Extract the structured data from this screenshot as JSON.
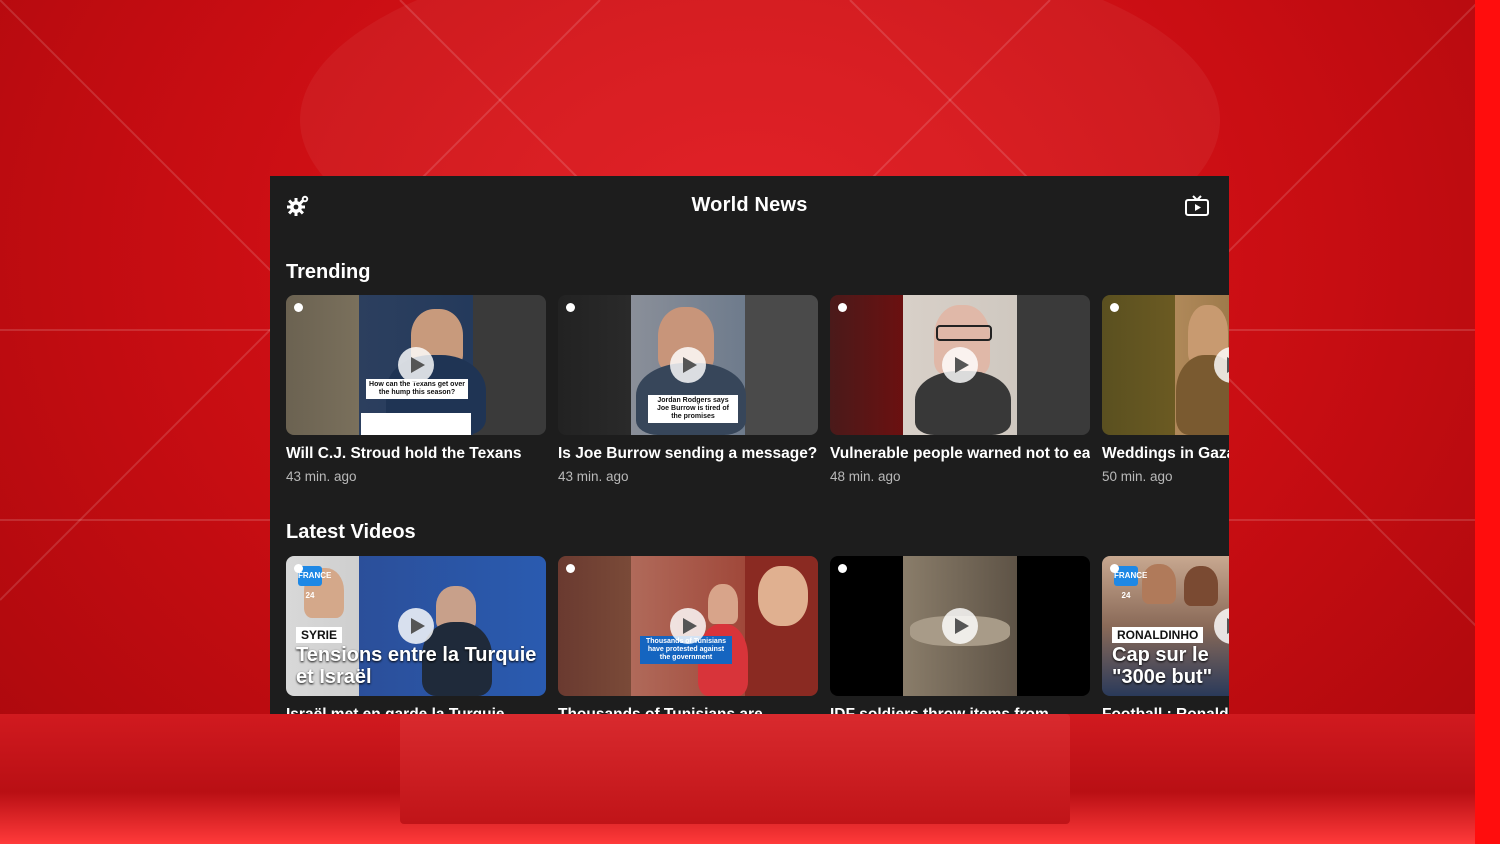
{
  "app": {
    "title": "World News"
  },
  "sections": [
    {
      "title": "Trending",
      "items": [
        {
          "title": "Will C.J. Stroud hold the Texans",
          "time": "43 min. ago"
        },
        {
          "title": "Is Joe Burrow sending a message?",
          "time": "43 min. ago"
        },
        {
          "title": "Vulnerable people warned not to eat",
          "time": "48 min. ago"
        },
        {
          "title": "Weddings in Gaza",
          "time": "50 min. ago"
        }
      ]
    },
    {
      "title": "Latest Videos",
      "items": [
        {
          "title": "Israël met en garde la Turquie",
          "tag": "SYRIE",
          "overlay": "Tensions entre la Turquie et Israël"
        },
        {
          "title": "Thousands of Tunisians are",
          "overlay": "Thousands of Tunisians have protested against the government"
        },
        {
          "title": "IDF soldiers throw items from"
        },
        {
          "title": "Football : Ronaldinho",
          "tag": "RONALDINHO",
          "overlay": "Cap sur le \"300e but\""
        }
      ]
    }
  ],
  "thumb_captions": {
    "t1": "How can the Texans get over the hump this season?",
    "t2": "Jordan Rodgers says Joe Burrow is tired of the promises",
    "latest_logo": "FRANCE 24"
  },
  "icons": {
    "settings": "gear-icon",
    "cast": "tv-play-icon",
    "play": "play-icon"
  },
  "colors": {
    "panel": "#1d1d1d",
    "background": "#d0151a",
    "muted_text": "#b9b9b9"
  }
}
